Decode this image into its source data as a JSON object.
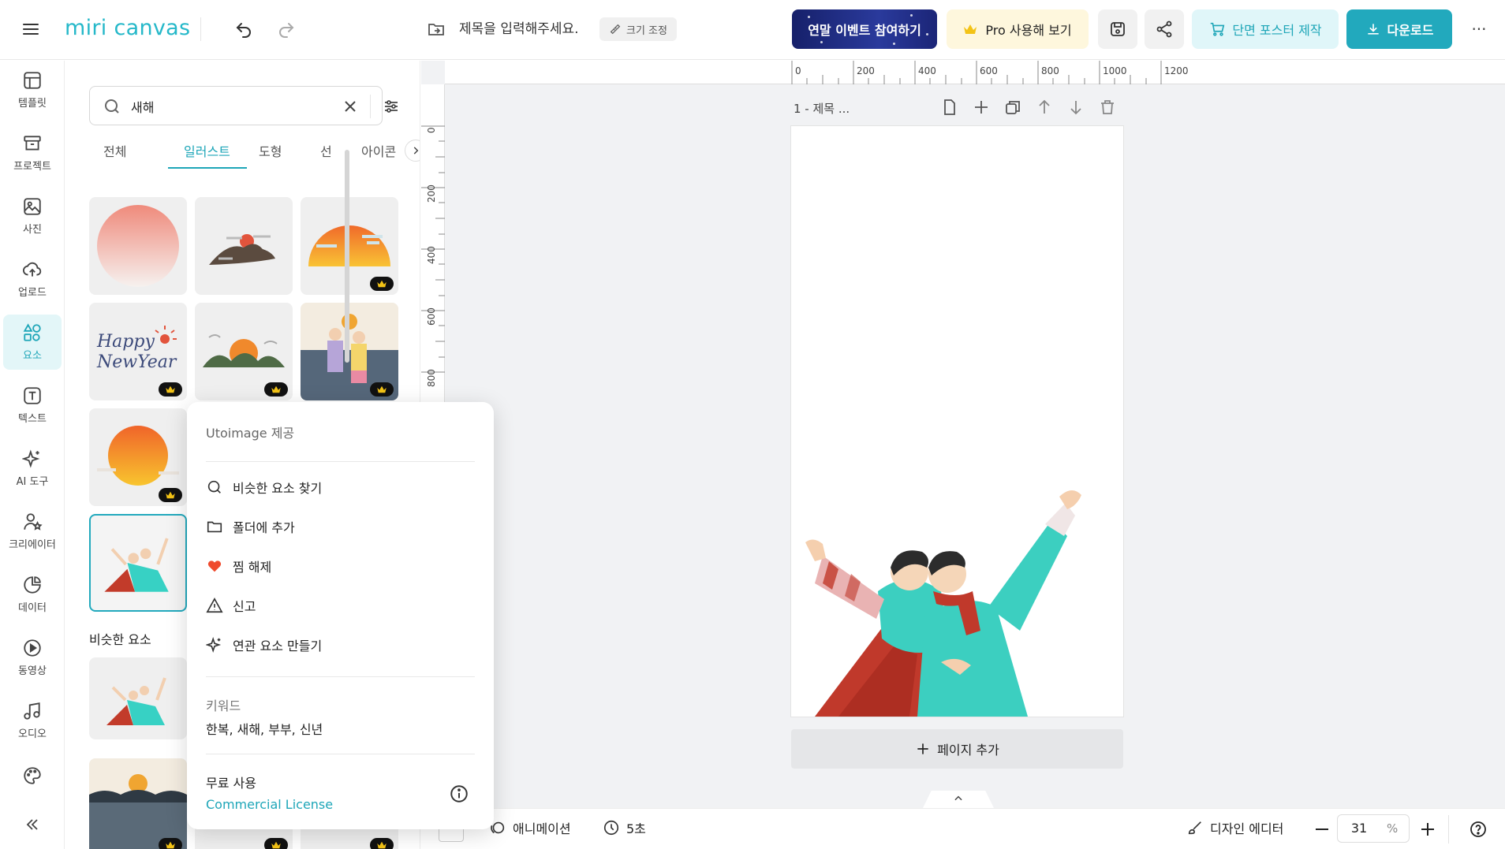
{
  "app": {
    "logo_text": "miri canvas",
    "title_placeholder": "제목을 입력해주세요.",
    "resize_label": "크기 조정",
    "event_label": "연말 이벤트 참여하기",
    "pro_label": "Pro 사용해 보기",
    "poster_label": "단면 포스터 제작",
    "download_label": "다운로드",
    "more_label": "···",
    "accent_color": "#22a9bd"
  },
  "rail": {
    "items": [
      {
        "label": "템플릿",
        "icon": "template-icon"
      },
      {
        "label": "프로젝트",
        "icon": "project-icon"
      },
      {
        "label": "사진",
        "icon": "photo-icon"
      },
      {
        "label": "업로드",
        "icon": "upload-icon"
      },
      {
        "label": "요소",
        "icon": "elements-icon",
        "active": true
      },
      {
        "label": "텍스트",
        "icon": "text-icon"
      },
      {
        "label": "AI 도구",
        "icon": "ai-tools-icon"
      },
      {
        "label": "크리에이터",
        "icon": "creator-icon"
      },
      {
        "label": "데이터",
        "icon": "data-icon"
      },
      {
        "label": "동영상",
        "icon": "video-icon"
      },
      {
        "label": "오디오",
        "icon": "audio-icon"
      }
    ]
  },
  "panel": {
    "search_value": "새해",
    "tabs": [
      "전체",
      "일러스트",
      "도형",
      "선",
      "아이콘"
    ],
    "active_tab": "일러스트",
    "similar_title": "비슷한 요소"
  },
  "canvas": {
    "ruler_h": [
      "0",
      "200",
      "400",
      "600",
      "800",
      "1000",
      "1200"
    ],
    "ruler_v": [
      "0",
      "200",
      "400",
      "600",
      "800"
    ],
    "page_label": "1 - 제목 ...",
    "add_page_label": "페이지 추가"
  },
  "bottombar": {
    "animation_label": "애니메이션",
    "duration_label": "5초",
    "editor_label": "디자인 에디터",
    "zoom_value": "31",
    "zoom_unit": "%"
  },
  "context_menu": {
    "provider": "Utoimage 제공",
    "items": [
      "비슷한 요소 찾기",
      "폴더에 추가",
      "찜 해제",
      "신고",
      "연관 요소 만들기"
    ],
    "keywords_label": "키워드",
    "keywords": "한복, 새해, 부부, 신년",
    "usage": "무료 사용",
    "license": "Commercial License"
  }
}
